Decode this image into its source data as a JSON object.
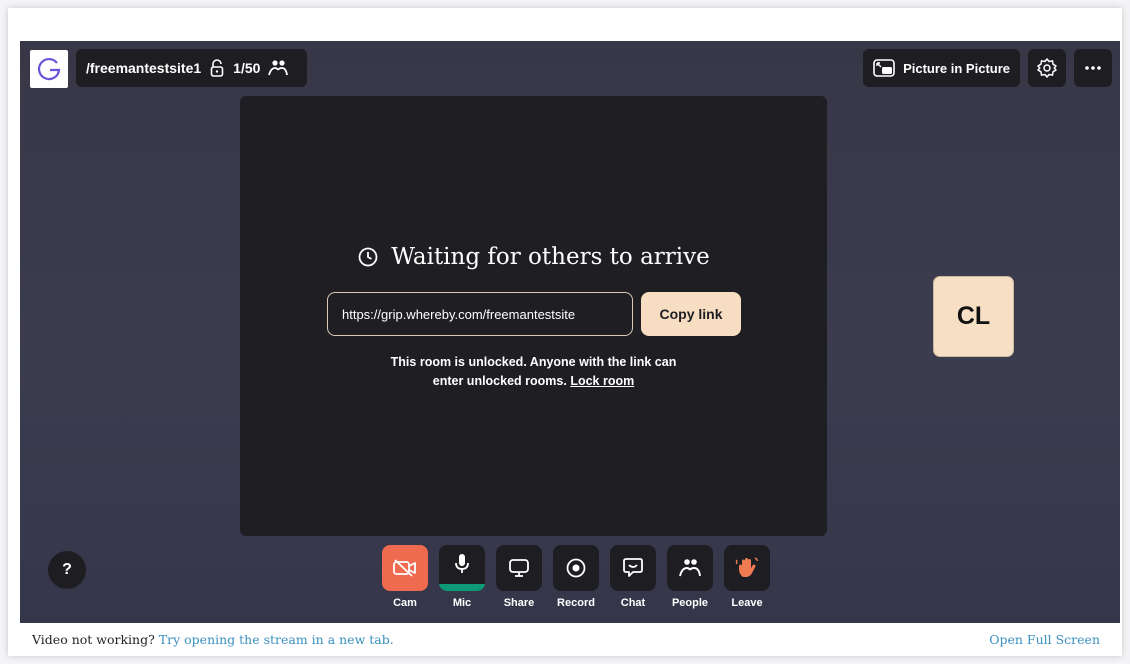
{
  "topbar": {
    "room_name": "/freemantestsite1",
    "participants": "1/50",
    "pip_label": "Picture in Picture"
  },
  "main": {
    "waiting_title": "Waiting for others to arrive",
    "room_link": "https://grip.whereby.com/freemantestsite",
    "copy_label": "Copy link",
    "unlock_line1": "This room is unlocked. Anyone with the link can",
    "unlock_line2": "enter unlocked rooms.",
    "lock_link": "Lock room"
  },
  "avatar": {
    "initials": "CL"
  },
  "help": {
    "label": "?"
  },
  "toolbar": {
    "cam": "Cam",
    "mic": "Mic",
    "share": "Share",
    "record": "Record",
    "chat": "Chat",
    "people": "People",
    "leave": "Leave"
  },
  "footer": {
    "prefix": "Video not working?",
    "link": "Try opening the stream in a new tab.",
    "fullscreen": "Open Full Screen"
  },
  "colors": {
    "cam_active": "#ef6a4f",
    "mic_level": "#0f9a77",
    "copy_button": "#f7dec3",
    "link_blue": "#3a8fc0"
  }
}
